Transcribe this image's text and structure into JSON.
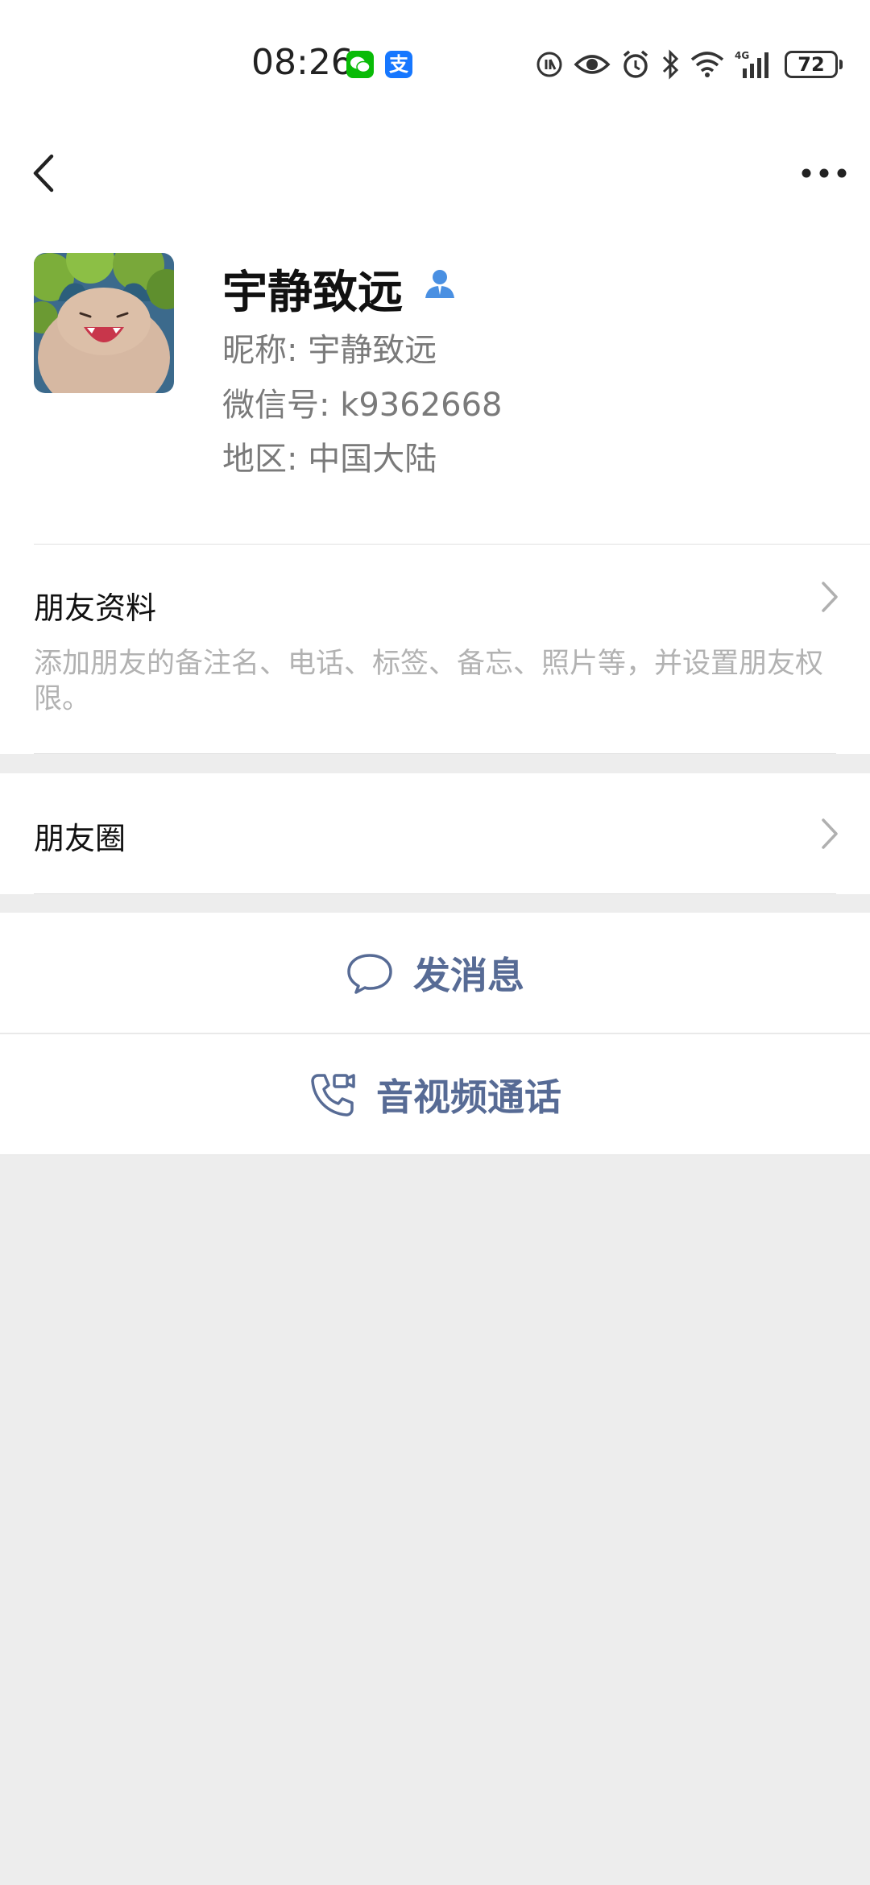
{
  "status_bar": {
    "time": "08:26",
    "app_badges": [
      {
        "name": "wechat-notification-icon",
        "color": "#09bb07"
      },
      {
        "name": "alipay-notification-icon",
        "color": "#1677ff",
        "glyph": "支"
      }
    ],
    "battery": "72"
  },
  "nav": {
    "back_icon": "chevron-left-icon",
    "more_icon": "more-dots-icon"
  },
  "profile": {
    "display_name": "宇静致远",
    "nickname_line": "昵称:  宇静致远",
    "wechat_id_line": "微信号:  k9362668",
    "region_line": "地区:  中国大陆",
    "verify_icon_color": "#4a90e2"
  },
  "friend_info": {
    "title": "朋友资料",
    "description": "添加朋友的备注名、电话、标签、备忘、照片等，并设置朋友权限。"
  },
  "moments": {
    "title": "朋友圈"
  },
  "actions": {
    "message_label": "发消息",
    "call_label": "音视频通话",
    "accent_color": "#576b95"
  }
}
